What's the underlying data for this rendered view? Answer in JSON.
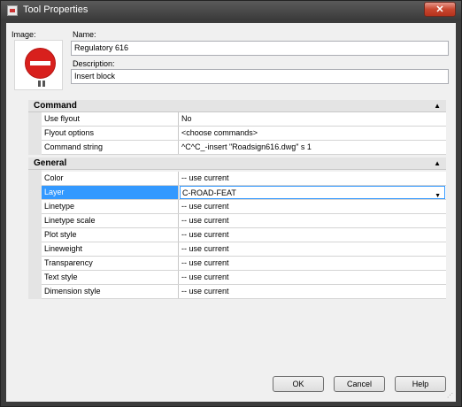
{
  "window": {
    "title": "Tool Properties",
    "close_label": "✕"
  },
  "image_label": "Image:",
  "name": {
    "label": "Name:",
    "value": "Regulatory 616"
  },
  "description": {
    "label": "Description:",
    "value": "Insert block"
  },
  "sections": {
    "command": {
      "title": "Command",
      "rows": [
        {
          "name": "Use flyout",
          "value": "No"
        },
        {
          "name": "Flyout options",
          "value": "<choose commands>"
        },
        {
          "name": "Command string",
          "value": "^C^C_-insert \"Roadsign616.dwg\" s 1"
        }
      ]
    },
    "general": {
      "title": "General",
      "rows": [
        {
          "name": "Color",
          "value": "-- use current"
        },
        {
          "name": "Layer",
          "value": "C-ROAD-FEAT"
        },
        {
          "name": "Linetype",
          "value": "-- use current"
        },
        {
          "name": "Linetype scale",
          "value": "-- use current"
        },
        {
          "name": "Plot style",
          "value": "-- use current"
        },
        {
          "name": "Lineweight",
          "value": "-- use current"
        },
        {
          "name": "Transparency",
          "value": "-- use current"
        },
        {
          "name": "Text style",
          "value": "-- use current"
        },
        {
          "name": "Dimension  style",
          "value": "-- use current"
        }
      ]
    }
  },
  "buttons": {
    "ok": "OK",
    "cancel": "Cancel",
    "help": "Help"
  },
  "colors": {
    "selection": "#3399ff",
    "sign_red": "#d8201d"
  }
}
